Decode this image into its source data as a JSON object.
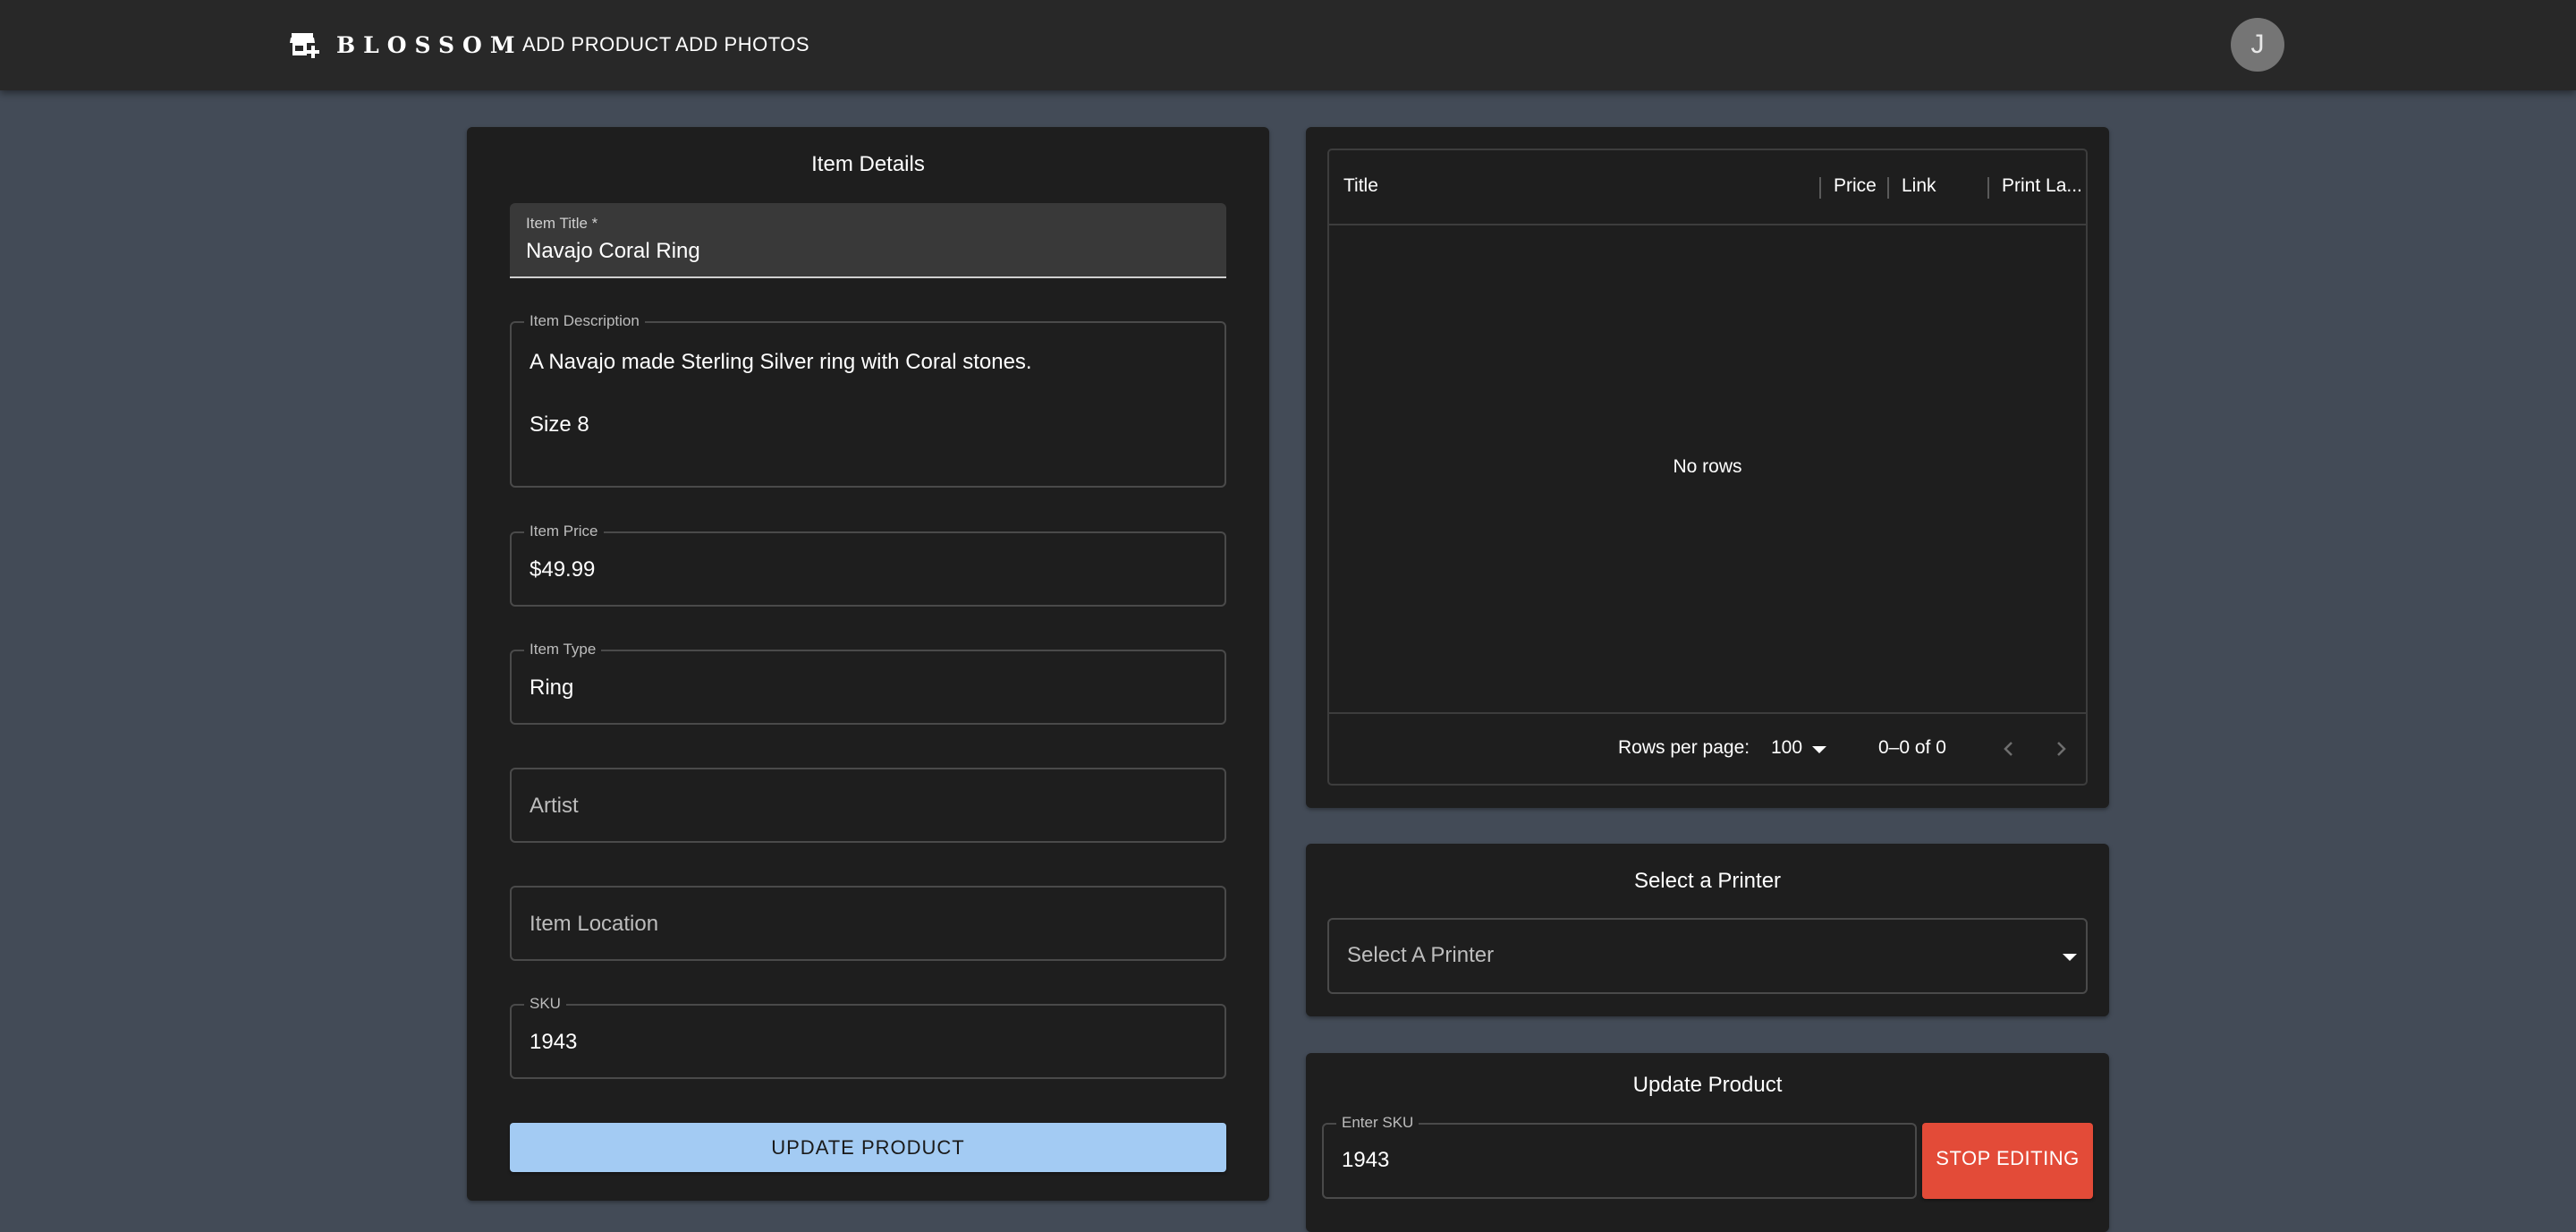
{
  "app": {
    "brand": "BLOSSOM",
    "nav": [
      "ADD PRODUCT",
      "ADD PHOTOS"
    ],
    "avatar_initial": "J"
  },
  "item_details": {
    "title": "Item Details",
    "item_title": {
      "label": "Item Title *",
      "value": "Navajo Coral Ring"
    },
    "item_description": {
      "label": "Item Description",
      "value": "A Navajo made Sterling Silver ring with Coral stones.\n\nSize 8"
    },
    "item_price": {
      "label": "Item Price",
      "value": "$49.99"
    },
    "item_type": {
      "label": "Item Type",
      "value": "Ring"
    },
    "artist": {
      "placeholder": "Artist"
    },
    "item_location": {
      "placeholder": "Item Location"
    },
    "sku": {
      "label": "SKU",
      "value": "1943"
    },
    "update_button": "UPDATE PRODUCT"
  },
  "table": {
    "columns": [
      "Title",
      "Price",
      "Link",
      "Print La..."
    ],
    "empty_text": "No rows",
    "rows_per_page_label": "Rows per page:",
    "rows_per_page_value": "100",
    "pagination_text": "0–0 of 0"
  },
  "printer": {
    "title": "Select a Printer",
    "placeholder": "Select A Printer"
  },
  "update_product": {
    "title": "Update Product",
    "sku_label": "Enter SKU",
    "sku_value": "1943",
    "stop_button": "STOP EDITING"
  },
  "colors": {
    "background": "#434b57",
    "appbar": "#282828",
    "panel": "#1e1e1e",
    "primary_button": "#a3cbf3",
    "danger_button": "#e34b38"
  }
}
